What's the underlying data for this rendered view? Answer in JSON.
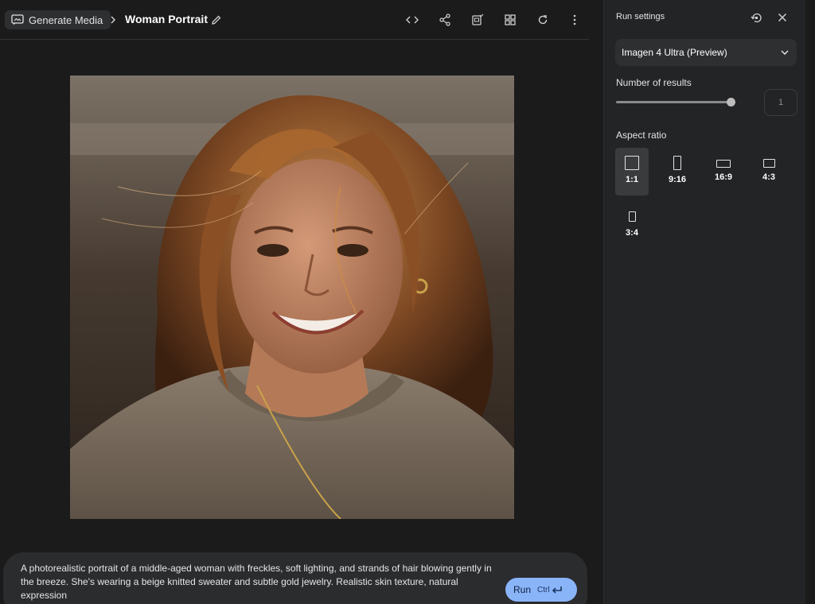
{
  "header": {
    "breadcrumb_root": "Generate Media",
    "title": "Woman Portrait",
    "toolbar_icons": [
      "code-icon",
      "share-icon",
      "compare-icon",
      "grid-icon",
      "refresh-icon",
      "more-vert-icon"
    ]
  },
  "prompt": {
    "text": "A photorealistic portrait of a middle-aged woman with freckles, soft lighting, and strands of hair blowing gently in the breeze. She's wearing a beige knitted sweater and subtle gold jewelry. Realistic skin texture, natural expression",
    "run_label": "Run",
    "shortcut": "Ctrl"
  },
  "settings": {
    "title": "Run settings",
    "model": "Imagen 4 Ultra (Preview)",
    "results_label": "Number of results",
    "results_value": "1",
    "aspect_label": "Aspect ratio",
    "ratios": [
      {
        "label": "1:1",
        "selected": true
      },
      {
        "label": "9:16",
        "selected": false
      },
      {
        "label": "16:9",
        "selected": false
      },
      {
        "label": "4:3",
        "selected": false
      },
      {
        "label": "3:4",
        "selected": false
      }
    ]
  },
  "colors": {
    "accent": "#8ab4f8",
    "background": "#1b1b1b",
    "panel": "#232426"
  }
}
